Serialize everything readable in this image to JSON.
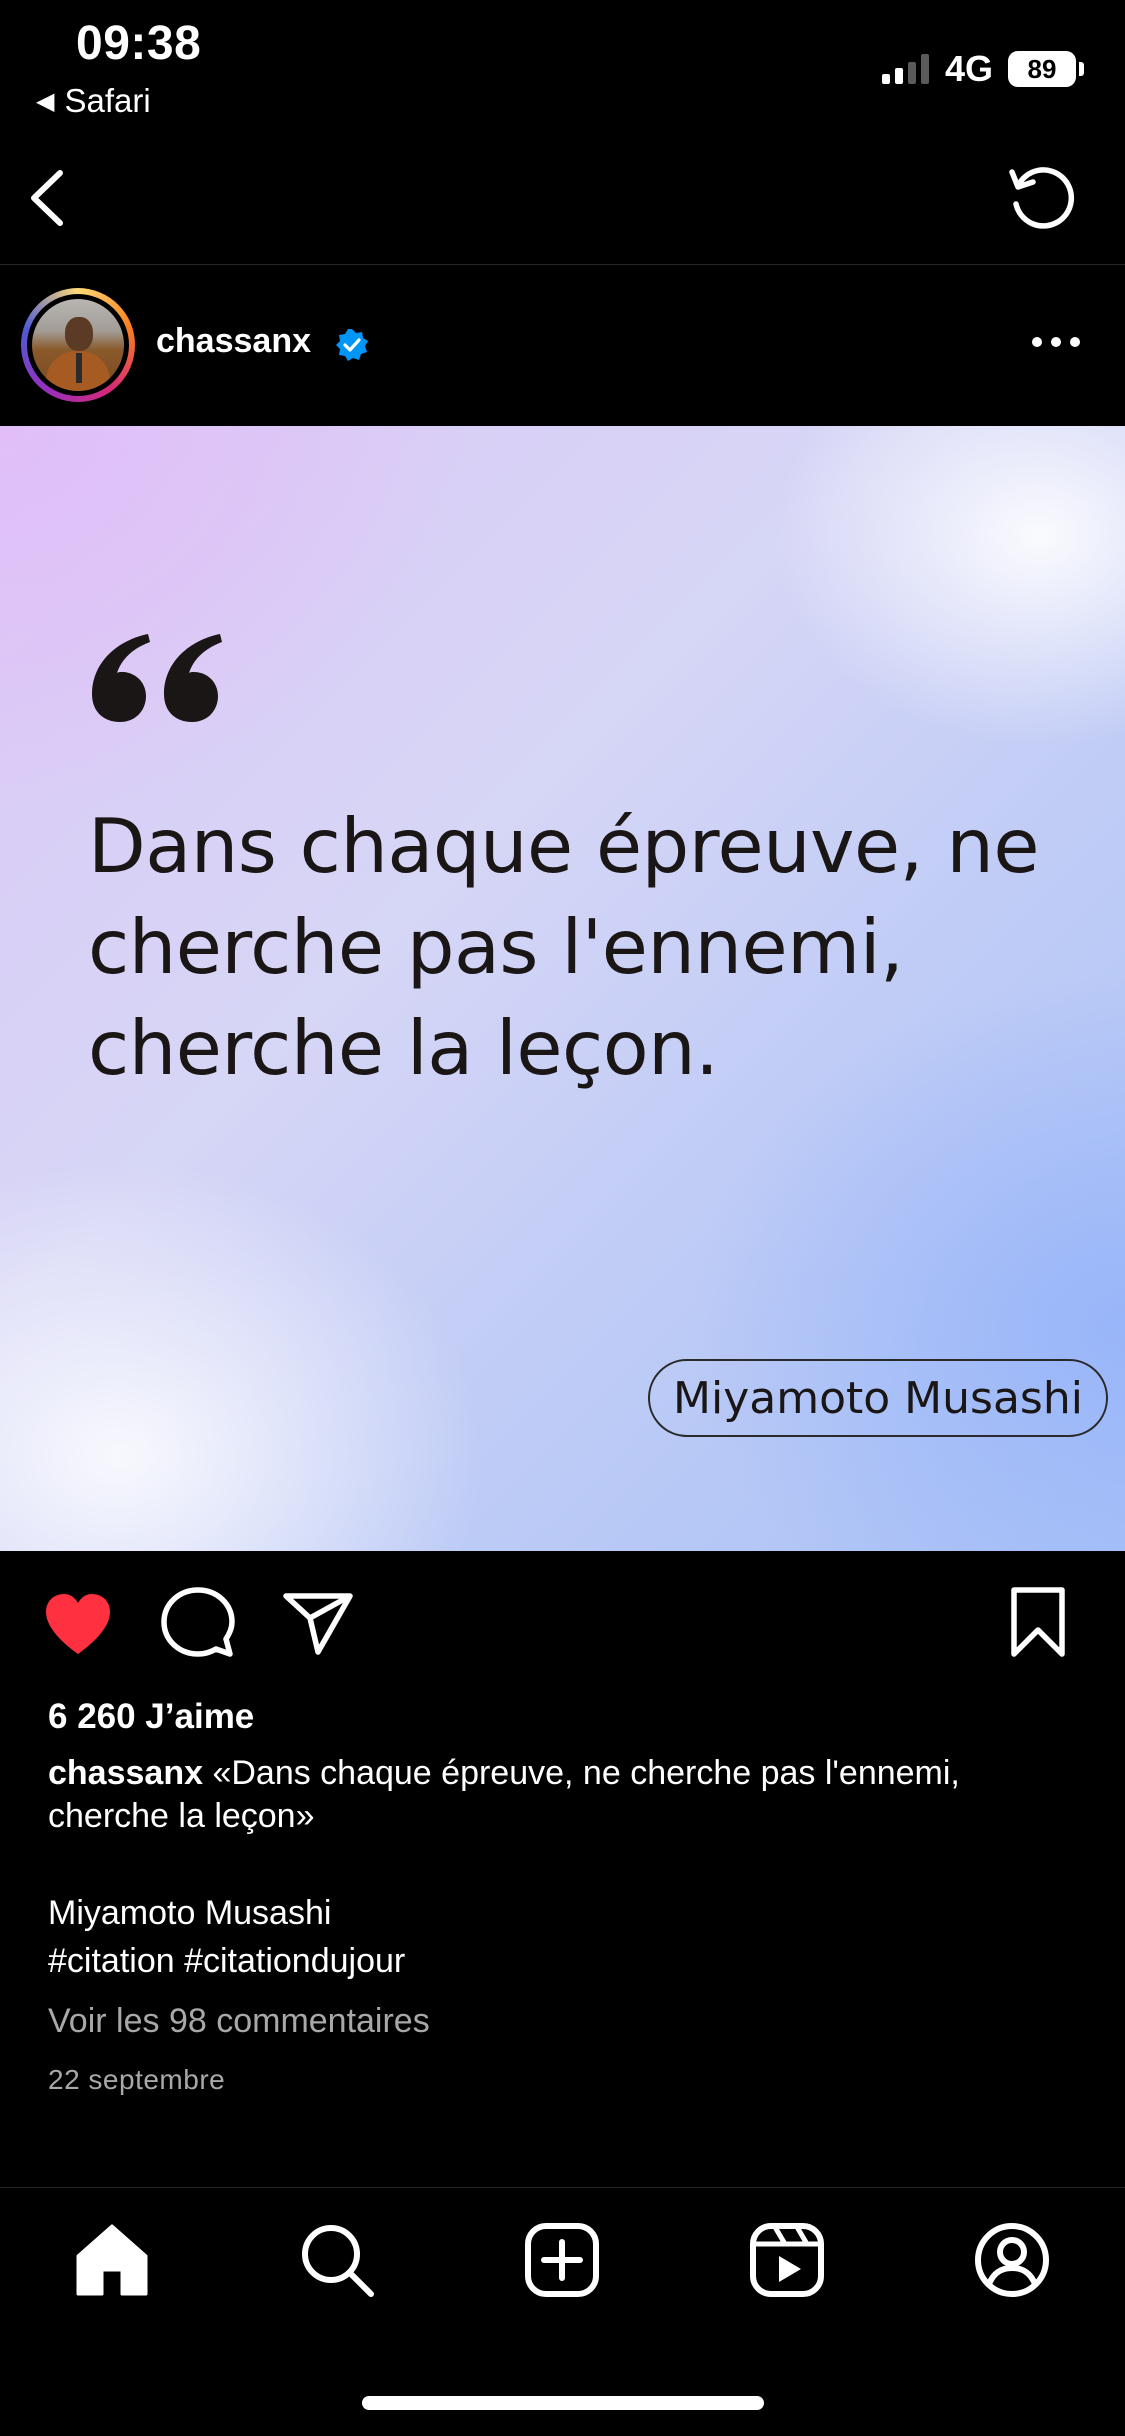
{
  "status_bar": {
    "time": "09:38",
    "back_app": "Safari",
    "network": "4G",
    "battery": "89"
  },
  "post": {
    "username": "chassanx",
    "image": {
      "quote": "Dans chaque épreuve, ne cherche pas l'ennemi, cherche la leçon.",
      "author": "Miyamoto Musashi"
    },
    "likes": "6 260 J’aime",
    "caption_user": "chassanx",
    "caption_text": " «Dans chaque épreuve, ne cherche pas l'ennemi, cherche la leçon»",
    "caption_author": "Miyamoto Musashi",
    "hashtags": "#citation #citationdujour",
    "comments_link": "Voir les 98 commentaires",
    "date": "22 septembre"
  },
  "icons": {
    "back": "chevron-left-icon",
    "refresh": "refresh-icon",
    "verified": "verified-badge-icon",
    "more": "more-dots-icon",
    "like": "heart-icon",
    "comment": "comment-icon",
    "share": "send-icon",
    "save": "bookmark-icon",
    "tabs": [
      "home-icon",
      "search-icon",
      "create-icon",
      "reels-icon",
      "profile-icon"
    ]
  },
  "colors": {
    "background": "#000000",
    "like_active": "#ff3040",
    "verified": "#0095f6",
    "secondary_text": "#a8a8a8"
  }
}
